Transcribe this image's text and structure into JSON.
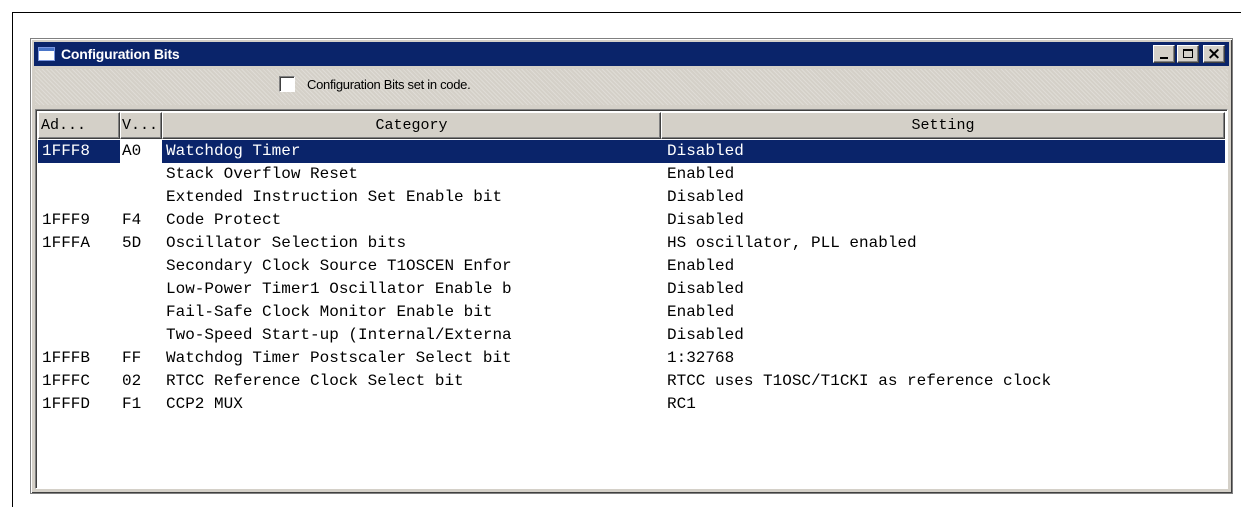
{
  "window": {
    "title": "Configuration Bits",
    "controls": {
      "minimize": "_",
      "maximize": "□",
      "close": "×"
    }
  },
  "toolbar": {
    "checkbox_label": "Configuration Bits set in code.",
    "checkbox_checked": false
  },
  "table": {
    "columns": {
      "address": "Ad...",
      "value": "V...",
      "category": "Category",
      "setting": "Setting"
    },
    "selected_row": 0,
    "rows": [
      {
        "address": "1FFF8",
        "value": "A0",
        "category": "Watchdog Timer",
        "setting": "Disabled"
      },
      {
        "address": "",
        "value": "",
        "category": "Stack Overflow Reset",
        "setting": "Enabled"
      },
      {
        "address": "",
        "value": "",
        "category": "Extended Instruction Set Enable bit",
        "setting": "Disabled"
      },
      {
        "address": "1FFF9",
        "value": "F4",
        "category": "Code Protect",
        "setting": "Disabled"
      },
      {
        "address": "1FFFA",
        "value": "5D",
        "category": "Oscillator Selection bits",
        "setting": "HS oscillator, PLL enabled"
      },
      {
        "address": "",
        "value": "",
        "category": "Secondary Clock Source T1OSCEN Enfor",
        "setting": "Enabled"
      },
      {
        "address": "",
        "value": "",
        "category": "Low-Power Timer1 Oscillator Enable b",
        "setting": "Disabled"
      },
      {
        "address": "",
        "value": "",
        "category": "Fail-Safe Clock Monitor Enable bit",
        "setting": "Enabled"
      },
      {
        "address": "",
        "value": "",
        "category": "Two-Speed Start-up (Internal/Externa",
        "setting": "Disabled"
      },
      {
        "address": "1FFFB",
        "value": "FF",
        "category": "Watchdog Timer Postscaler Select bit",
        "setting": "1:32768"
      },
      {
        "address": "1FFFC",
        "value": "02",
        "category": "RTCC Reference Clock Select bit",
        "setting": "RTCC uses T1OSC/T1CKI as reference clock"
      },
      {
        "address": "1FFFD",
        "value": "F1",
        "category": "CCP2 MUX",
        "setting": "RC1"
      }
    ]
  },
  "colors": {
    "titlebar": "#0a246a",
    "selection": "#0a246a",
    "face": "#d4d0c8"
  }
}
